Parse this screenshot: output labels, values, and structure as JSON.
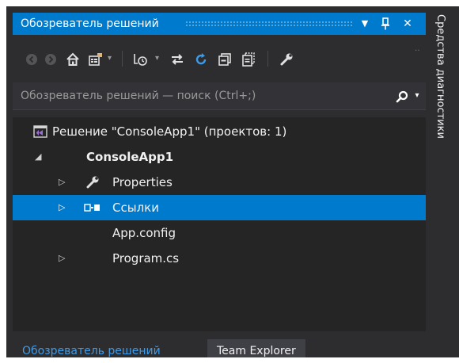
{
  "window": {
    "title": "Обозреватель решений",
    "controls": {
      "dropdown": "▾",
      "pin": "📌",
      "close": "✕"
    }
  },
  "toolbar": {
    "icons": [
      "back-icon",
      "forward-icon",
      "home-icon",
      "switch-views-icon",
      "pending-changes-filter-icon",
      "sync-icon",
      "refresh-icon",
      "collapse-all-icon",
      "show-all-files-icon",
      "properties-icon"
    ]
  },
  "search": {
    "placeholder": "Обозреватель решений — поиск (Ctrl+;)"
  },
  "tree": {
    "solution": "Решение \"ConsoleApp1\"  (проектов: 1)",
    "project": "ConsoleApp1",
    "items": [
      {
        "label": "Properties"
      },
      {
        "label": "Ссылки"
      },
      {
        "label": "App.config"
      },
      {
        "label": "Program.cs"
      }
    ]
  },
  "tabs": {
    "active": "Обозреватель решений",
    "inactive": "Team Explorer"
  },
  "side_tab": {
    "label": "Средства диагностики"
  },
  "colors": {
    "accent": "#007acc",
    "background": "#252526",
    "chrome": "#2d2d30",
    "text": "#f1f1f1"
  }
}
